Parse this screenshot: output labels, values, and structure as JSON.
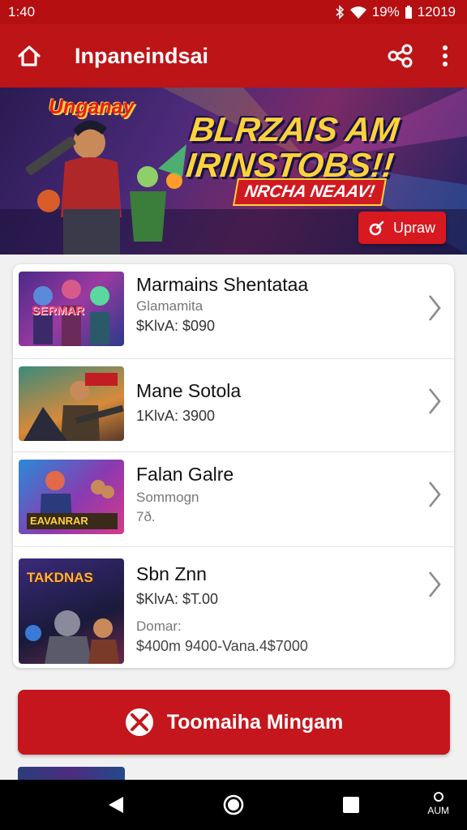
{
  "status_bar": {
    "time": "1:40",
    "battery": "19%",
    "clock_right": "12019"
  },
  "app_bar": {
    "title": "Inpaneindsai"
  },
  "banner": {
    "logo": "Unganay",
    "headline_line1": "BLRZAIS AM",
    "headline_line2": "IRINSTOBS!!",
    "tagline": "NRCHA NEAAV!",
    "action_label": "Upraw",
    "colors": {
      "headline": "#ffd23b",
      "accent": "#d8191f"
    }
  },
  "games": [
    {
      "name": "Marmains Shentataa",
      "sub": "Glamamita",
      "meta": "$KlvA: $090",
      "extra": "",
      "thumb_text": "SERMAR"
    },
    {
      "name": "Mane Sotola",
      "sub": "",
      "meta": "1KlvA: 3900",
      "extra": "",
      "thumb_text": ""
    },
    {
      "name": "Falan Galre",
      "sub": "Sommogn",
      "meta": "7ð.",
      "extra": "",
      "thumb_text": "EAVANRAR"
    },
    {
      "name": "Sbn Znn",
      "sub": "",
      "meta": "$KlvA: $T.00",
      "detail_label": "Domar:",
      "detail_value": "$400m 9400-Vana.4$7000",
      "thumb_text": "TAKDNAS"
    }
  ],
  "cta": {
    "label": "Toomaiha Mingam"
  },
  "nav": {
    "extra_label": "AUM"
  },
  "colors": {
    "primary": "#bd1418",
    "statusbar": "#b50f12",
    "background": "#f1f1f1"
  }
}
